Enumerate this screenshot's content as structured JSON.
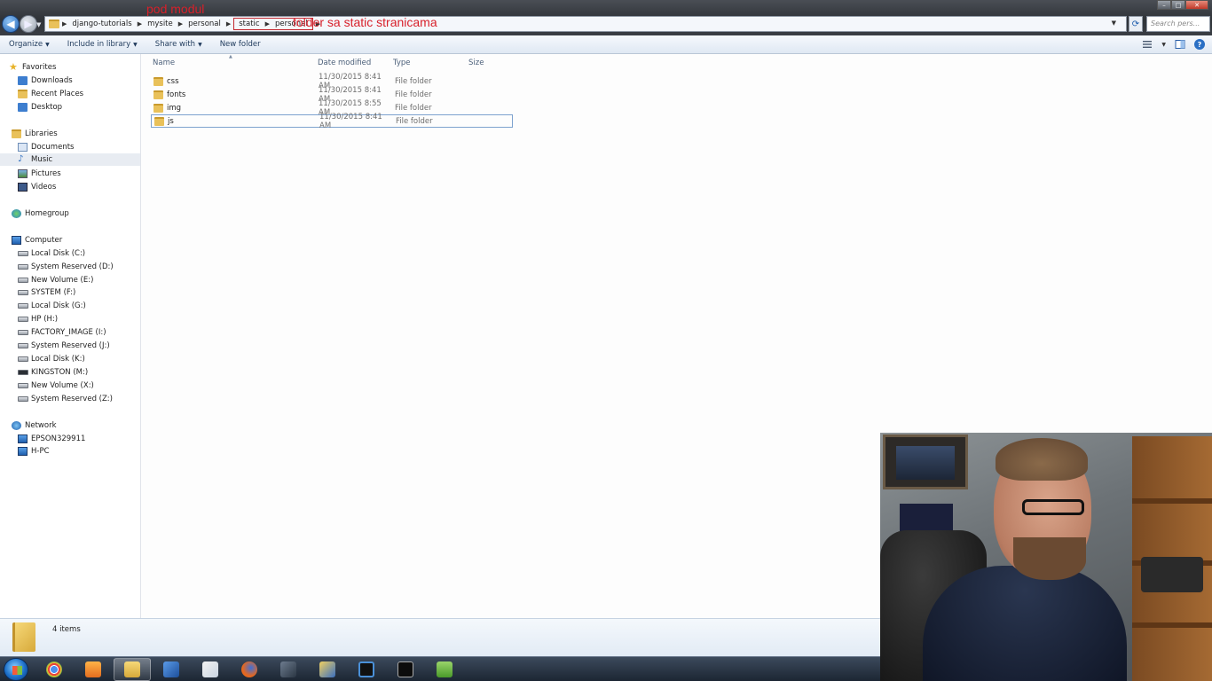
{
  "window": {
    "breadcrumbs": [
      "django-tutorials",
      "mysite",
      "personal",
      "static",
      "personal"
    ],
    "search_placeholder": "Search pers...",
    "annotations": {
      "top": "pod modul",
      "right": "folder sa static stranicama"
    }
  },
  "toolbar": {
    "organize": "Organize",
    "include_in_library": "Include in library",
    "share_with": "Share with",
    "new_folder": "New folder"
  },
  "nav": {
    "favorites": "Favorites",
    "downloads": "Downloads",
    "recent_places": "Recent Places",
    "desktop": "Desktop",
    "libraries": "Libraries",
    "documents": "Documents",
    "music": "Music",
    "pictures": "Pictures",
    "videos": "Videos",
    "homegroup": "Homegroup",
    "computer": "Computer",
    "drives": [
      "Local Disk (C:)",
      "System Reserved (D:)",
      "New Volume (E:)",
      "SYSTEM (F:)",
      "Local Disk (G:)",
      "HP (H:)",
      "FACTORY_IMAGE (I:)",
      "System Reserved (J:)",
      "Local Disk (K:)",
      "KINGSTON (M:)",
      "New Volume (X:)",
      "System Reserved (Z:)"
    ],
    "network": "Network",
    "network_items": [
      "EPSON329911",
      "H-PC"
    ]
  },
  "columns": {
    "name": "Name",
    "date": "Date modified",
    "type": "Type",
    "size": "Size"
  },
  "files": [
    {
      "name": "css",
      "date": "11/30/2015 8:41 AM",
      "type": "File folder"
    },
    {
      "name": "fonts",
      "date": "11/30/2015 8:41 AM",
      "type": "File folder"
    },
    {
      "name": "img",
      "date": "11/30/2015 8:55 AM",
      "type": "File folder"
    },
    {
      "name": "js",
      "date": "11/30/2015 8:41 AM",
      "type": "File folder"
    }
  ],
  "status": {
    "item_count": "4 items"
  },
  "taskbar": {
    "apps": [
      "chrome-icon",
      "media-player-icon",
      "explorer-icon",
      "text-editor-icon",
      "paint-icon",
      "firefox-icon",
      "network-tool-icon",
      "remote-desktop-icon",
      "monitor-app-icon",
      "cmd-icon",
      "notepadpp-icon"
    ]
  }
}
